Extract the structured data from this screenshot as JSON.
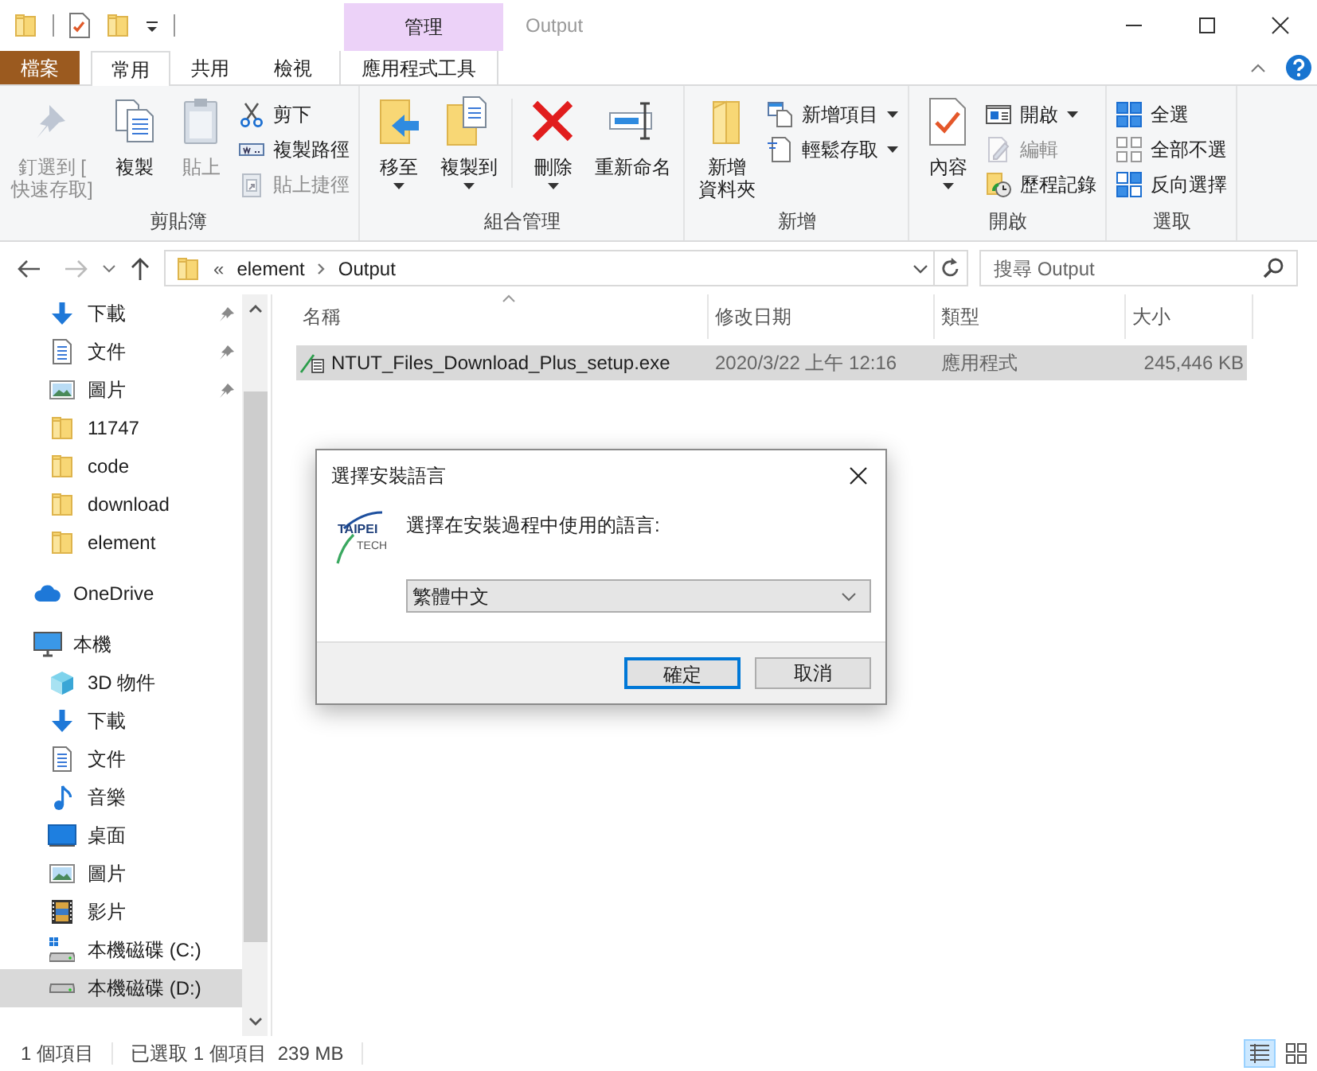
{
  "window": {
    "title": "Output",
    "contextual_group": "管理"
  },
  "ribbon_tabs": [
    {
      "label": "檔案",
      "kind": "file",
      "selected": false
    },
    {
      "label": "常用",
      "kind": "tab",
      "selected": true
    },
    {
      "label": "共用",
      "kind": "tab",
      "selected": false
    },
    {
      "label": "檢視",
      "kind": "tab",
      "selected": false
    },
    {
      "label": "應用程式工具",
      "kind": "contextual",
      "selected": false
    }
  ],
  "ribbon_groups": [
    {
      "label": "剪貼簿",
      "items": [
        {
          "kind": "large",
          "label_lines": [
            "釘選到 [",
            "快速存取]"
          ],
          "disabled": true,
          "dropdown": false
        },
        {
          "kind": "large",
          "label": "複製",
          "disabled": false,
          "dropdown": false
        },
        {
          "kind": "large",
          "label": "貼上",
          "disabled": true,
          "dropdown": false
        },
        {
          "kind": "small",
          "label": "剪下",
          "disabled": false,
          "dropdown": false
        },
        {
          "kind": "small",
          "label": "複製路徑",
          "disabled": false,
          "dropdown": false
        },
        {
          "kind": "small",
          "label": "貼上捷徑",
          "disabled": true,
          "dropdown": false
        }
      ]
    },
    {
      "label": "組合管理",
      "items": [
        {
          "kind": "large",
          "label": "移至",
          "disabled": false,
          "dropdown": true
        },
        {
          "kind": "large",
          "label": "複製到",
          "disabled": false,
          "dropdown": true
        },
        {
          "kind": "separator"
        },
        {
          "kind": "large",
          "label": "刪除",
          "disabled": false,
          "dropdown": true
        },
        {
          "kind": "large",
          "label": "重新命名",
          "disabled": false,
          "dropdown": false
        }
      ]
    },
    {
      "label": "新增",
      "items": [
        {
          "kind": "large",
          "label_lines": [
            "新增",
            "資料夾"
          ],
          "disabled": false,
          "dropdown": false
        },
        {
          "kind": "small",
          "label": "新增項目",
          "disabled": false,
          "dropdown": true
        },
        {
          "kind": "small",
          "label": "輕鬆存取",
          "disabled": false,
          "dropdown": true
        }
      ]
    },
    {
      "label": "開啟",
      "items": [
        {
          "kind": "large",
          "label": "內容",
          "disabled": false,
          "dropdown": true
        },
        {
          "kind": "small",
          "label": "開啟",
          "disabled": false,
          "dropdown": true
        },
        {
          "kind": "small",
          "label": "編輯",
          "disabled": true,
          "dropdown": false
        },
        {
          "kind": "small",
          "label": "歷程記錄",
          "disabled": false,
          "dropdown": false
        }
      ]
    },
    {
      "label": "選取",
      "items": [
        {
          "kind": "small",
          "label": "全選",
          "disabled": false,
          "dropdown": false
        },
        {
          "kind": "small",
          "label": "全部不選",
          "disabled": false,
          "dropdown": false
        },
        {
          "kind": "small",
          "label": "反向選擇",
          "disabled": false,
          "dropdown": false
        }
      ]
    }
  ],
  "address_bar": {
    "overflow": "«",
    "path": [
      "element",
      "Output"
    ],
    "forward_disabled": true
  },
  "search": {
    "placeholder": "搜尋 Output"
  },
  "sidebar": {
    "quick_access": [
      {
        "label": "下載",
        "pinned": true,
        "selected": false
      },
      {
        "label": "文件",
        "pinned": true,
        "selected": false
      },
      {
        "label": "圖片",
        "pinned": true,
        "selected": false
      },
      {
        "label": "11747",
        "pinned": false,
        "selected": false
      },
      {
        "label": "code",
        "pinned": false,
        "selected": false
      },
      {
        "label": "download",
        "pinned": false,
        "selected": false
      },
      {
        "label": "element",
        "pinned": false,
        "selected": false
      }
    ],
    "tree": [
      {
        "label": "OneDrive",
        "selected": false
      },
      {
        "label": "本機",
        "selected": false,
        "children": [
          {
            "label": "3D 物件",
            "selected": false
          },
          {
            "label": "下載",
            "selected": false
          },
          {
            "label": "文件",
            "selected": false
          },
          {
            "label": "音樂",
            "selected": false
          },
          {
            "label": "桌面",
            "selected": false
          },
          {
            "label": "圖片",
            "selected": false
          },
          {
            "label": "影片",
            "selected": false
          },
          {
            "label": "本機磁碟 (C:)",
            "selected": false
          },
          {
            "label": "本機磁碟 (D:)",
            "selected": true
          }
        ]
      }
    ]
  },
  "table": {
    "columns": [
      {
        "label": "名稱",
        "sorted": true
      },
      {
        "label": "修改日期",
        "sorted": false
      },
      {
        "label": "類型",
        "sorted": false
      },
      {
        "label": "大小",
        "sorted": false
      }
    ],
    "rows": [
      {
        "name": "NTUT_Files_Download_Plus_setup.exe",
        "modified": "2020/3/22 上午 12:16",
        "type": "應用程式",
        "size": "245,446 KB",
        "selected": true
      }
    ]
  },
  "status_bar": {
    "item_count": "1 個項目",
    "selection": "已選取 1 個項目",
    "selection_size": "239 MB",
    "views": [
      {
        "selected": true
      },
      {
        "selected": false
      }
    ]
  },
  "dialog": {
    "title": "選擇安裝語言",
    "logo_text": [
      "TAIPEI",
      "TECH"
    ],
    "prompt": "選擇在安裝過程中使用的語言:",
    "language": "繁體中文",
    "buttons": [
      {
        "label": "確定",
        "default": true
      },
      {
        "label": "取消",
        "default": false
      }
    ]
  }
}
